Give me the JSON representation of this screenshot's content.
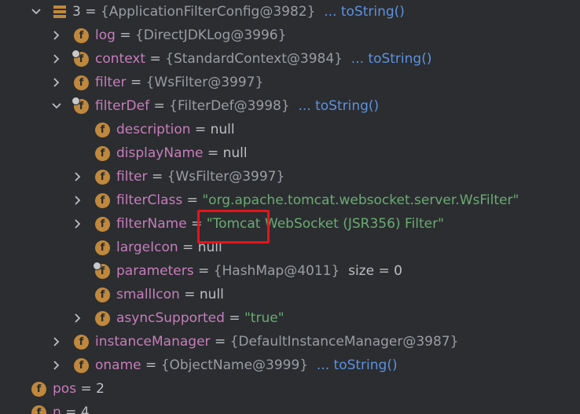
{
  "rows": {
    "r0": {
      "label": "3",
      "eq": " = ",
      "value": "{ApplicationFilterConfig@3982}",
      "gap": "  ",
      "tostring": "... toString()"
    },
    "r1": {
      "name": "log",
      "eq": " = ",
      "value": "{DirectJDKLog@3996}"
    },
    "r2": {
      "name": "context",
      "eq": " = ",
      "value": "{StandardContext@3984}",
      "gap": "  ",
      "tostring": "... toString()"
    },
    "r3": {
      "name": "filter",
      "eq": " = ",
      "value": "{WsFilter@3997}"
    },
    "r4": {
      "name": "filterDef",
      "eq": " = ",
      "value": "{FilterDef@3998}",
      "gap": "  ",
      "tostring": "... toString()"
    },
    "r5": {
      "name": "description",
      "eq": " = ",
      "value": "null"
    },
    "r6": {
      "name": "displayName",
      "eq": " = ",
      "value": "null"
    },
    "r7": {
      "name": "filter",
      "eq": " = ",
      "value": "{WsFilter@3997}"
    },
    "r8": {
      "name": "filterClass",
      "eq": " = ",
      "value": "\"org.apache.tomcat.websocket.server.WsFilter\""
    },
    "r9": {
      "name": "filterName",
      "eq": " = ",
      "value": "\"Tomcat WebSocket (JSR356) Filter\""
    },
    "r10": {
      "name": "largeIcon",
      "eq": " = ",
      "value": "null"
    },
    "r11": {
      "name": "parameters",
      "eq": " = ",
      "value": "{HashMap@4011}",
      "gap": "  ",
      "extra": "size = 0"
    },
    "r12": {
      "name": "smallIcon",
      "eq": " = ",
      "value": "null"
    },
    "r13": {
      "name": "asyncSupported",
      "eq": " = ",
      "value": "\"true\""
    },
    "r14": {
      "name": "instanceManager",
      "eq": " = ",
      "value": "{DefaultInstanceManager@3987}"
    },
    "r15": {
      "name": "oname",
      "eq": " = ",
      "value": "{ObjectName@3999}",
      "gap": "  ",
      "tostring": "... toString()"
    },
    "r16": {
      "name": "pos",
      "eq": " = ",
      "value": "2"
    },
    "r17": {
      "name": "n",
      "eq": " = ",
      "value": "4"
    }
  },
  "icons": {
    "field": "f",
    "arrow_icon": "array-icon",
    "expand": "chevron-right-icon",
    "collapse": "chevron-down-icon"
  },
  "colors": {
    "background": "#2b2d30",
    "field_icon": "#c0883c",
    "name": "#c77dbb",
    "object_ref": "#9a9da3",
    "to_string_link": "#5c92e0",
    "string_value": "#6aab73",
    "highlight": "#e8131a"
  }
}
